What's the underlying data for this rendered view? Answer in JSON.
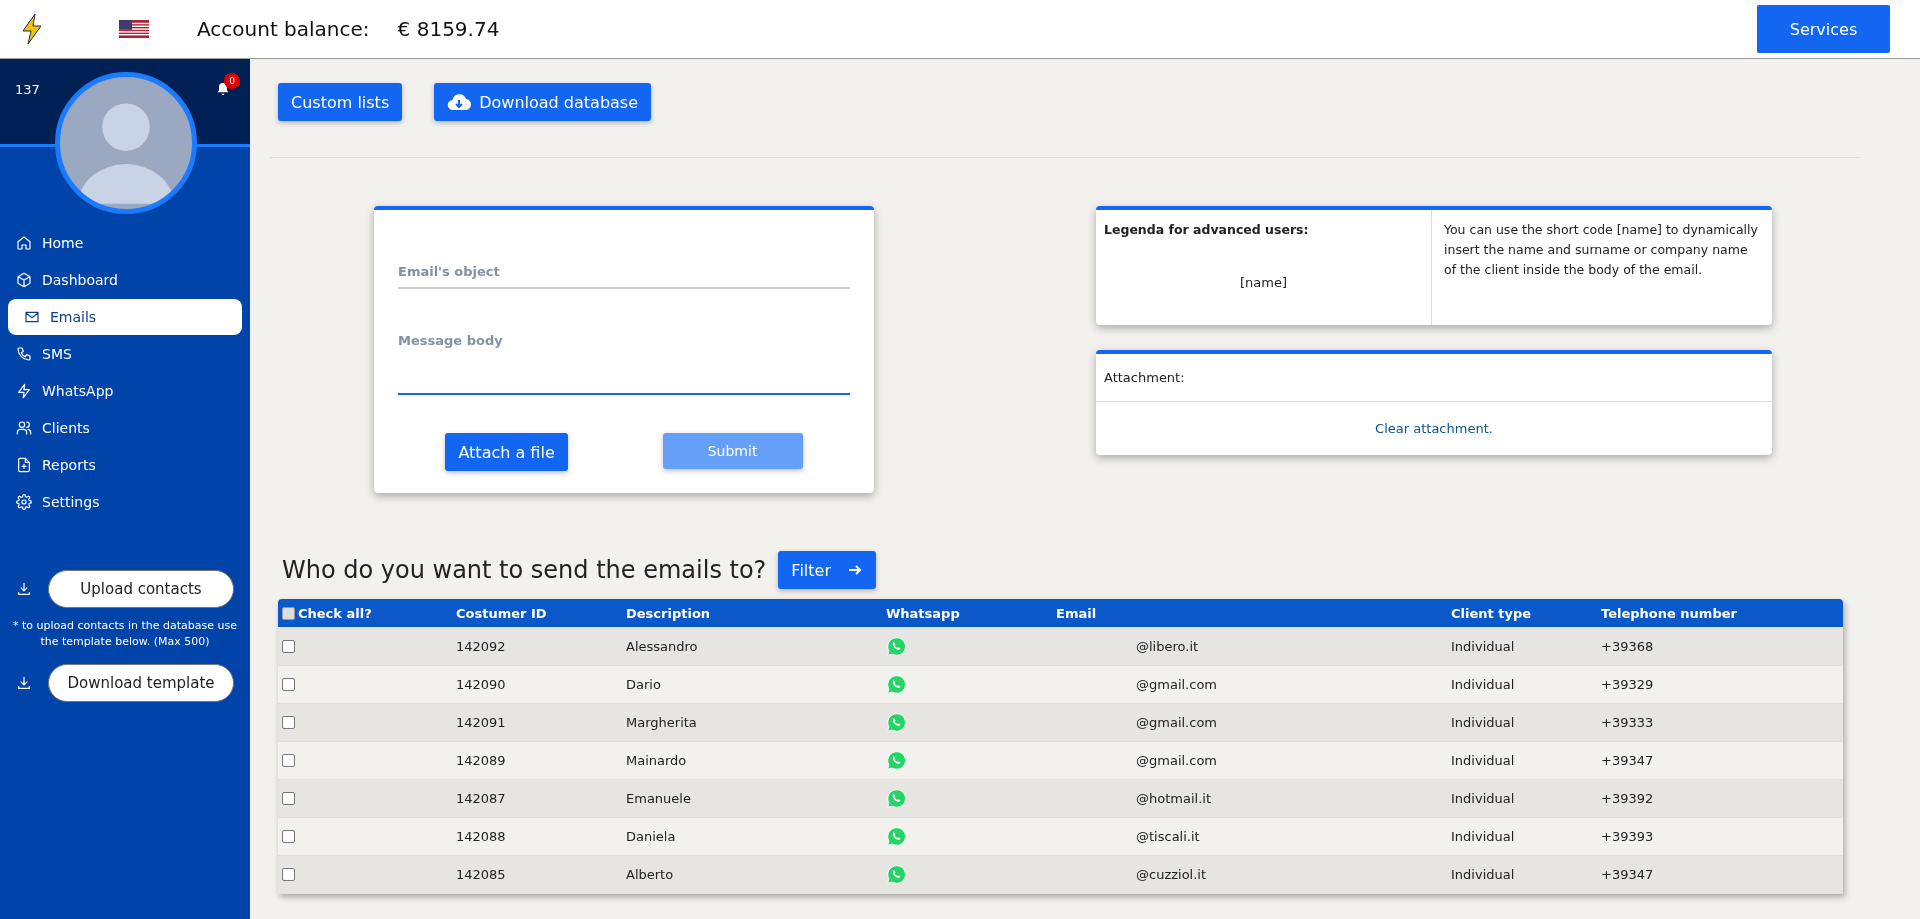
{
  "header": {
    "balance_label": "Account balance:",
    "balance_value": "€ 8159.74",
    "services_button": "Services"
  },
  "sidebar": {
    "user_id": "137",
    "notification_count": "0",
    "items": [
      {
        "label": "Home",
        "selected": false
      },
      {
        "label": "Dashboard",
        "selected": false
      },
      {
        "label": "Emails",
        "selected": true
      },
      {
        "label": "SMS",
        "selected": false
      },
      {
        "label": "WhatsApp",
        "selected": false
      },
      {
        "label": "Clients",
        "selected": false
      },
      {
        "label": "Reports",
        "selected": false
      },
      {
        "label": "Settings",
        "selected": false
      }
    ],
    "upload_button": "Upload contacts",
    "upload_note": "* to upload contacts in the database use the template below. (Max 500)",
    "template_button": "Download template"
  },
  "toolbar": {
    "custom_lists_button": "Custom lists",
    "download_button": "Download database"
  },
  "form": {
    "subject_placeholder": "Email's object",
    "body_placeholder": "Message body",
    "attach_button": "Attach a file",
    "submit_button": {
      "label": "Submit",
      "disabled": true
    }
  },
  "legend": {
    "title": "Legenda for advanced users:",
    "code": "[name]",
    "description": "You can use the short code [name] to dynamically insert the name and surname or company name of the client inside the body of the email."
  },
  "attachment": {
    "label": "Attachment:",
    "clear_link": "Clear attachment."
  },
  "recipients": {
    "heading": "Who do you want to send the emails to?",
    "filter_button": "Filter",
    "check_all": {
      "label": "Check all?",
      "checked": false
    },
    "columns": [
      "Costumer ID",
      "Description",
      "Whatsapp",
      "Email",
      "Client type",
      "Telephone number"
    ],
    "rows": [
      {
        "checked": false,
        "id": "142092",
        "description": "Alessandro",
        "email": "@libero.it",
        "client_type": "Individual",
        "phone": "+39368"
      },
      {
        "checked": false,
        "id": "142090",
        "description": "Dario",
        "email": "@gmail.com",
        "client_type": "Individual",
        "phone": "+39329"
      },
      {
        "checked": false,
        "id": "142091",
        "description": "Margherita",
        "email": "@gmail.com",
        "client_type": "Individual",
        "phone": "+39333"
      },
      {
        "checked": false,
        "id": "142089",
        "description": "Mainardo",
        "email": "@gmail.com",
        "client_type": "Individual",
        "phone": "+39347"
      },
      {
        "checked": false,
        "id": "142087",
        "description": "Emanuele",
        "email": "@hotmail.it",
        "client_type": "Individual",
        "phone": "+39392"
      },
      {
        "checked": false,
        "id": "142088",
        "description": "Daniela",
        "email": "@tiscali.it",
        "client_type": "Individual",
        "phone": "+39393"
      },
      {
        "checked": false,
        "id": "142085",
        "description": "Alberto",
        "email": "@cuzziol.it",
        "client_type": "Individual",
        "phone": "+39347"
      }
    ]
  }
}
